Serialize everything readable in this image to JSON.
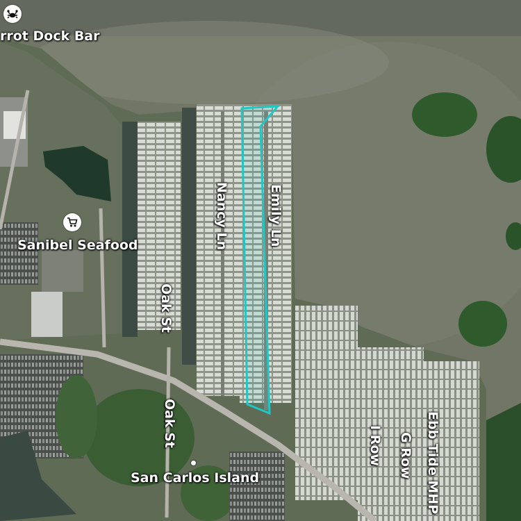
{
  "map": {
    "labels": {
      "parrot_dock_bar": "rrot Dock Bar",
      "sanibel_seafood": "Sanibel Seafood",
      "nancy_ln": "Nancy Ln",
      "emily_ln": "Emily Ln",
      "oak_st_north": "Oak St",
      "oak_st_south": "Oak St",
      "san_carlos_island": "San Carlos Island",
      "i_row": "I Row",
      "g_row": "G Row",
      "ebb_tide_mhp": "Ebb Tide MHP"
    },
    "icons": {
      "bar_poi": "crab-icon",
      "seafood_poi": "shopping-cart-icon",
      "place_marker": "place-dot-icon"
    },
    "colors": {
      "parcel_outline": "#21c7c4",
      "water": "#6f7466",
      "vegetation": "#2f5a2e",
      "label": "#ffffff"
    }
  }
}
